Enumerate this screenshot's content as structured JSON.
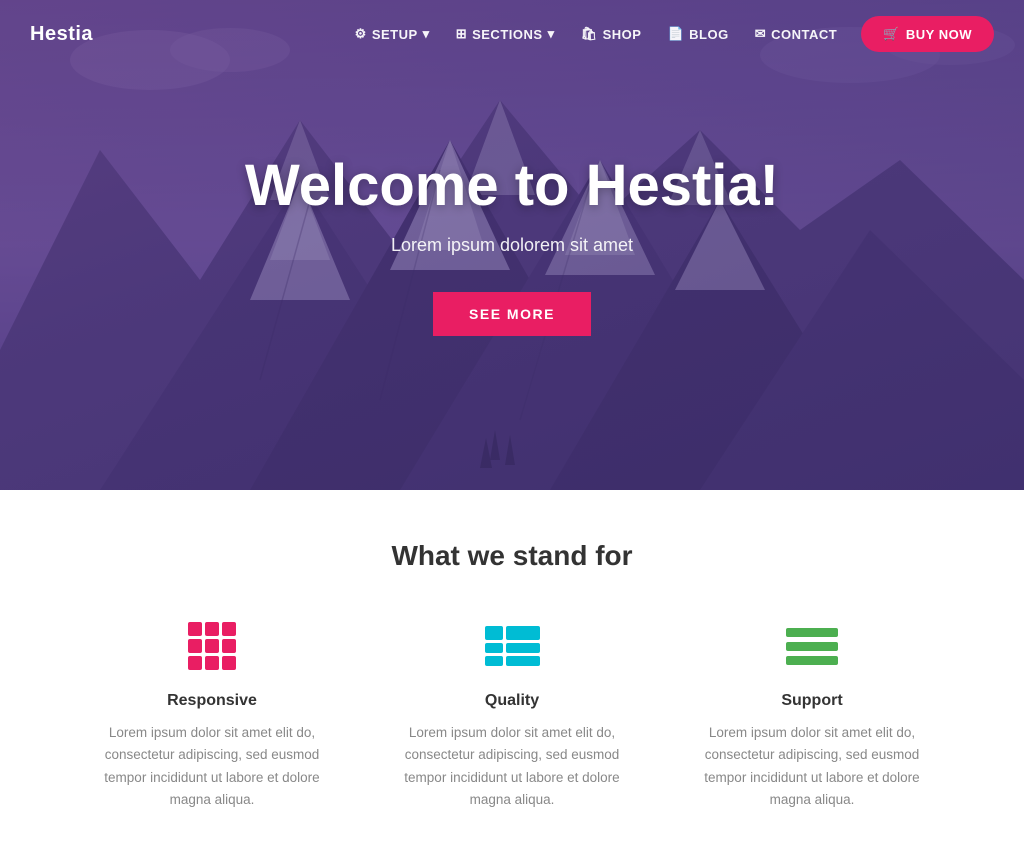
{
  "brand": {
    "name": "Hestia"
  },
  "navbar": {
    "links": [
      {
        "id": "setup",
        "label": "SETUP",
        "icon": "gear",
        "hasDropdown": true
      },
      {
        "id": "sections",
        "label": "SECTIONS",
        "icon": "grid",
        "hasDropdown": true
      },
      {
        "id": "shop",
        "label": "SHOP",
        "icon": "bag",
        "hasDropdown": false
      },
      {
        "id": "blog",
        "label": "BLOG",
        "icon": "file",
        "hasDropdown": false
      },
      {
        "id": "contact",
        "label": "CONTACT",
        "icon": "envelope",
        "hasDropdown": false
      }
    ],
    "cta": {
      "label": "BUY NOW",
      "icon": "cart"
    }
  },
  "hero": {
    "title": "Welcome to Hestia!",
    "subtitle": "Lorem ipsum dolorem sit amet",
    "cta_label": "SEE MORE"
  },
  "features": {
    "section_title": "What we stand for",
    "items": [
      {
        "id": "responsive",
        "name": "Responsive",
        "description": "Lorem ipsum dolor sit amet elit do, consectetur adipiscing, sed eusmod tempor incididunt ut labore et dolore magna aliqua."
      },
      {
        "id": "quality",
        "name": "Quality",
        "description": "Lorem ipsum dolor sit amet elit do, consectetur adipiscing, sed eusmod tempor incididunt ut labore et dolore magna aliqua."
      },
      {
        "id": "support",
        "name": "Support",
        "description": "Lorem ipsum dolor sit amet elit do, consectetur adipiscing, sed eusmod tempor incididunt ut labore et dolore magna aliqua."
      }
    ]
  }
}
